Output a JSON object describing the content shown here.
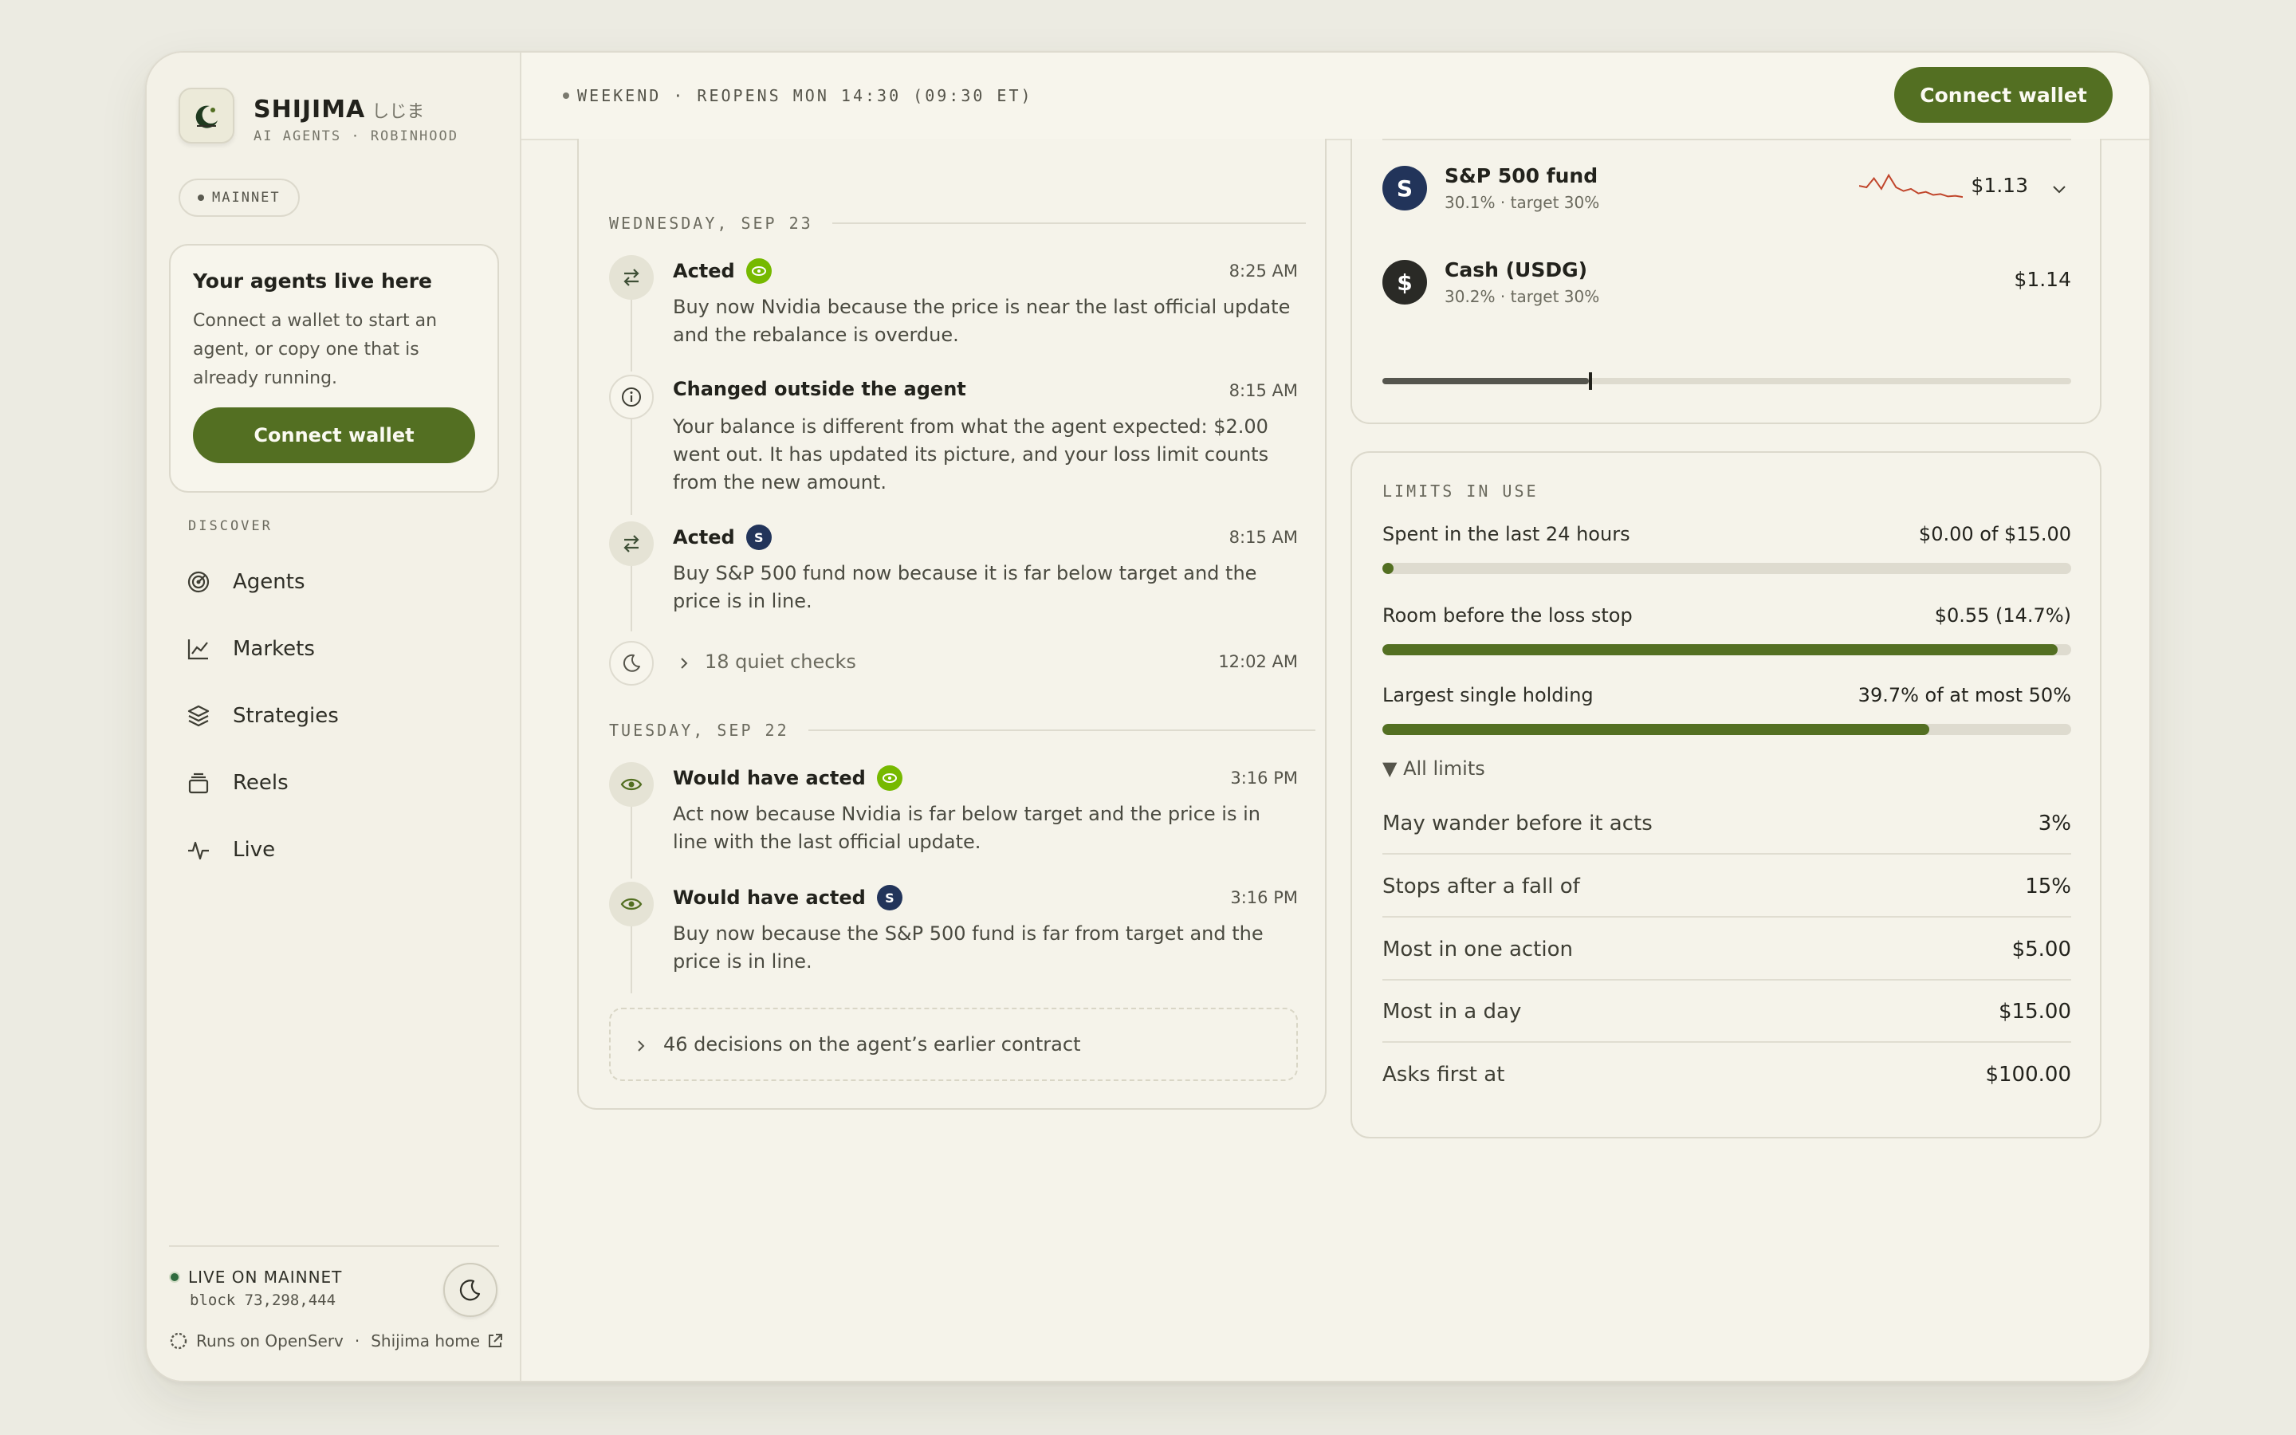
{
  "app": {
    "name": "SHIJIMA",
    "name_jp": "しじま",
    "subtitle": "AI AGENTS · ROBINHOOD",
    "network_pill": "MAINNET"
  },
  "sidebar_card": {
    "title": "Your agents live here",
    "text": "Connect a wallet to start an agent, or copy one that is already running.",
    "button": "Connect wallet"
  },
  "sidebar": {
    "section_label": "DISCOVER",
    "items": [
      {
        "label": "Agents",
        "icon": "radar-icon"
      },
      {
        "label": "Markets",
        "icon": "chart-icon"
      },
      {
        "label": "Strategies",
        "icon": "layers-icon"
      },
      {
        "label": "Reels",
        "icon": "stack-icon"
      },
      {
        "label": "Live",
        "icon": "pulse-icon"
      }
    ],
    "live_status": "LIVE ON MAINNET",
    "block": "block 73,298,444",
    "runs_on": "Runs on OpenServ",
    "separator": "·",
    "home_link": "Shijima home"
  },
  "topbar": {
    "status": "WEEKEND · REOPENS MON 14:30 (09:30 ET)",
    "button": "Connect wallet"
  },
  "feed": {
    "days": [
      {
        "label": "WEDNESDAY, SEP 23"
      },
      {
        "label": "TUESDAY, SEP 22"
      }
    ],
    "events": [
      {
        "title": "Acted",
        "time": "8:25 AM",
        "body": "Buy now Nvidia because the price is near the last official update and the rebalance is overdue.",
        "badge": "nvidia"
      },
      {
        "title": "Changed outside the agent",
        "time": "8:15 AM",
        "body": "Your balance is different from what the agent expected: $2.00 went out. It has updated its picture, and your loss limit counts from the new amount."
      },
      {
        "title": "Acted",
        "time": "8:15 AM",
        "body": "Buy S&P 500 fund now because it is far below target and the price is in line.",
        "badge": "sp500",
        "badge_letter": "S"
      },
      {
        "title": "18 quiet checks",
        "time": "12:02 AM"
      },
      {
        "title": "Would have acted",
        "time": "3:16 PM",
        "body": "Act now because Nvidia is far below target and the price is in line with the last official update.",
        "badge": "nvidia"
      },
      {
        "title": "Would have acted",
        "time": "3:16 PM",
        "body": "Buy now because the S&P 500 fund is far from target and the price is in line.",
        "badge": "sp500",
        "badge_letter": "S"
      }
    ],
    "earlier": "46 decisions on the agent’s earlier contract"
  },
  "holdings": [
    {
      "name": "S&P 500 fund",
      "sub": "30.1% · target 30%",
      "value": "$1.13",
      "avatar": "S",
      "color": "#22345a",
      "sparkline": [
        0.45,
        0.5,
        0.2,
        0.55,
        0.1,
        0.5,
        0.62,
        0.55,
        0.7,
        0.65,
        0.75,
        0.72,
        0.8,
        0.78,
        0.82
      ]
    },
    {
      "name": "Cash (USDG)",
      "sub": "30.2% · target 30%",
      "value": "$1.14",
      "avatar": "$",
      "color": "#2a2a26",
      "allocation_progress": 0.3,
      "target_marker": 0.3
    }
  ],
  "limits": {
    "title": "LIMITS IN USE",
    "bars": [
      {
        "label": "Spent in the last 24 hours",
        "value": "$0.00 of $15.00",
        "fill": 0.0
      },
      {
        "label": "Room before the loss stop",
        "value": "$0.55 (14.7%)",
        "fill": 0.98
      },
      {
        "label": "Largest single holding",
        "value": "39.7% of at most 50%",
        "fill": 0.794
      }
    ],
    "all_limits_label": "▼ All limits",
    "rows": [
      {
        "label": "May wander before it acts",
        "value": "3%"
      },
      {
        "label": "Stops after a fall of",
        "value": "15%"
      },
      {
        "label": "Most in one action",
        "value": "$5.00"
      },
      {
        "label": "Most in a day",
        "value": "$15.00"
      },
      {
        "label": "Asks first at",
        "value": "$100.00"
      }
    ]
  },
  "colors": {
    "accent": "#536f22",
    "background": "#ecebe2",
    "nvidia": "#76b900",
    "sp500": "#22345a"
  }
}
